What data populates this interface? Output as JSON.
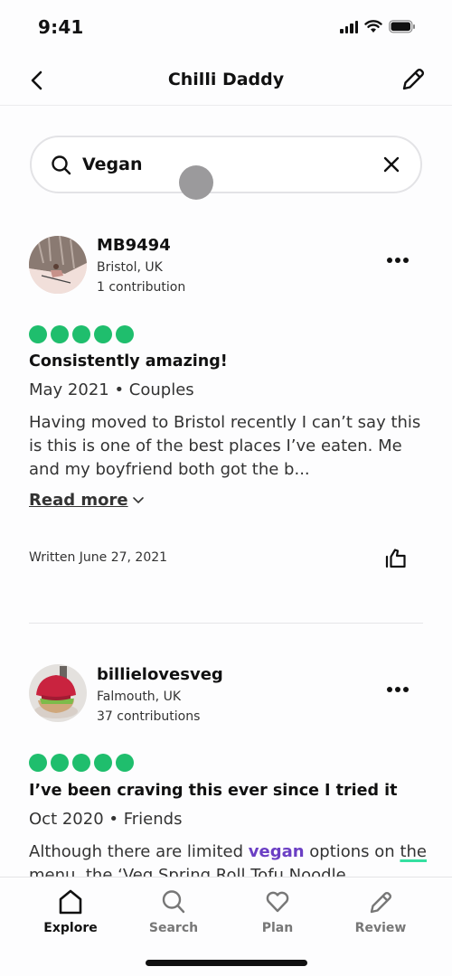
{
  "status_bar": {
    "time": "9:41"
  },
  "header": {
    "title": "Chilli Daddy"
  },
  "search": {
    "value": "Vegan",
    "placeholder": ""
  },
  "reviews": [
    {
      "user": "MB9494",
      "location": "Bristol, UK",
      "contributions": "1 contribution",
      "rating": 5,
      "title": "Consistently amazing!",
      "meta": "May 2021 • Couples",
      "body": "Having moved to Bristol recently I can’t say this is this is one of the best places I’ve eaten. Me and my boyfriend both got the b...",
      "read_more": "Read more",
      "written": "Written June 27, 2021"
    },
    {
      "user": "billielovesveg",
      "location": "Falmouth, UK",
      "contributions": "37 contributions",
      "rating": 5,
      "title": "I’ve been craving this ever since I tried it",
      "meta": "Oct 2020 • Friends",
      "body_parts": {
        "before": "Although there are limited ",
        "highlight": "vegan",
        "after": " options on ",
        "underlined": "the menu,",
        "rest": " the ‘Veg Spring Roll Tofu Noodle"
      }
    }
  ],
  "colors": {
    "rating_bubble": "#1fbe6d",
    "highlight": "#6b3fc4",
    "underline": "#34e0a1"
  },
  "bottom_nav": [
    {
      "label": "Explore",
      "icon": "home-icon",
      "active": true
    },
    {
      "label": "Search",
      "icon": "search-icon",
      "active": false
    },
    {
      "label": "Plan",
      "icon": "heart-icon",
      "active": false
    },
    {
      "label": "Review",
      "icon": "pencil-icon",
      "active": false
    }
  ]
}
